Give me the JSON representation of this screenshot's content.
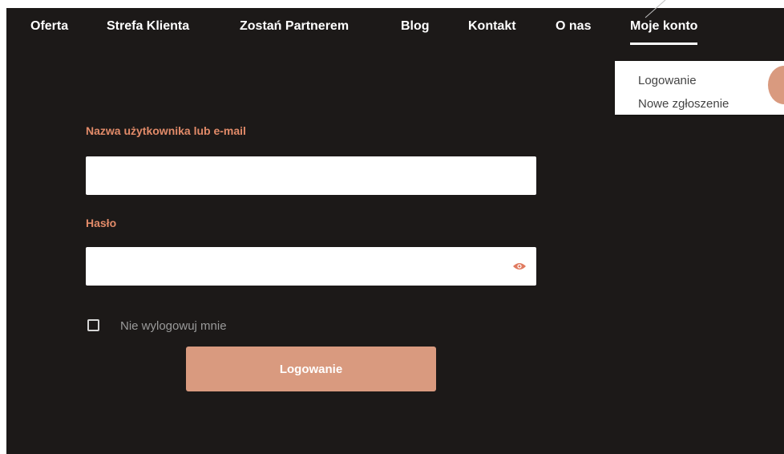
{
  "nav": {
    "items": [
      {
        "label": "Oferta"
      },
      {
        "label": "Strefa Klienta"
      },
      {
        "label": "Zostań Partnerem"
      },
      {
        "label": "Blog"
      },
      {
        "label": "Kontakt"
      },
      {
        "label": "O nas"
      },
      {
        "label": "Moje konto",
        "active": true
      }
    ]
  },
  "dropdown": {
    "items": [
      {
        "label": "Logowanie"
      },
      {
        "label": "Nowe zgłoszenie"
      }
    ]
  },
  "form": {
    "username_label": "Nazwa użytkownika lub e-mail",
    "username_value": "",
    "password_label": "Hasło",
    "password_value": "",
    "password_toggle_icon": "eye-icon",
    "remember_label": "Nie wylogowuj mnie",
    "remember_checked": false,
    "submit_label": "Logowanie"
  },
  "colors": {
    "background": "#1c1918",
    "accent": "#e28b69",
    "button": "#d99a7f",
    "nav_text": "#ffffff"
  }
}
